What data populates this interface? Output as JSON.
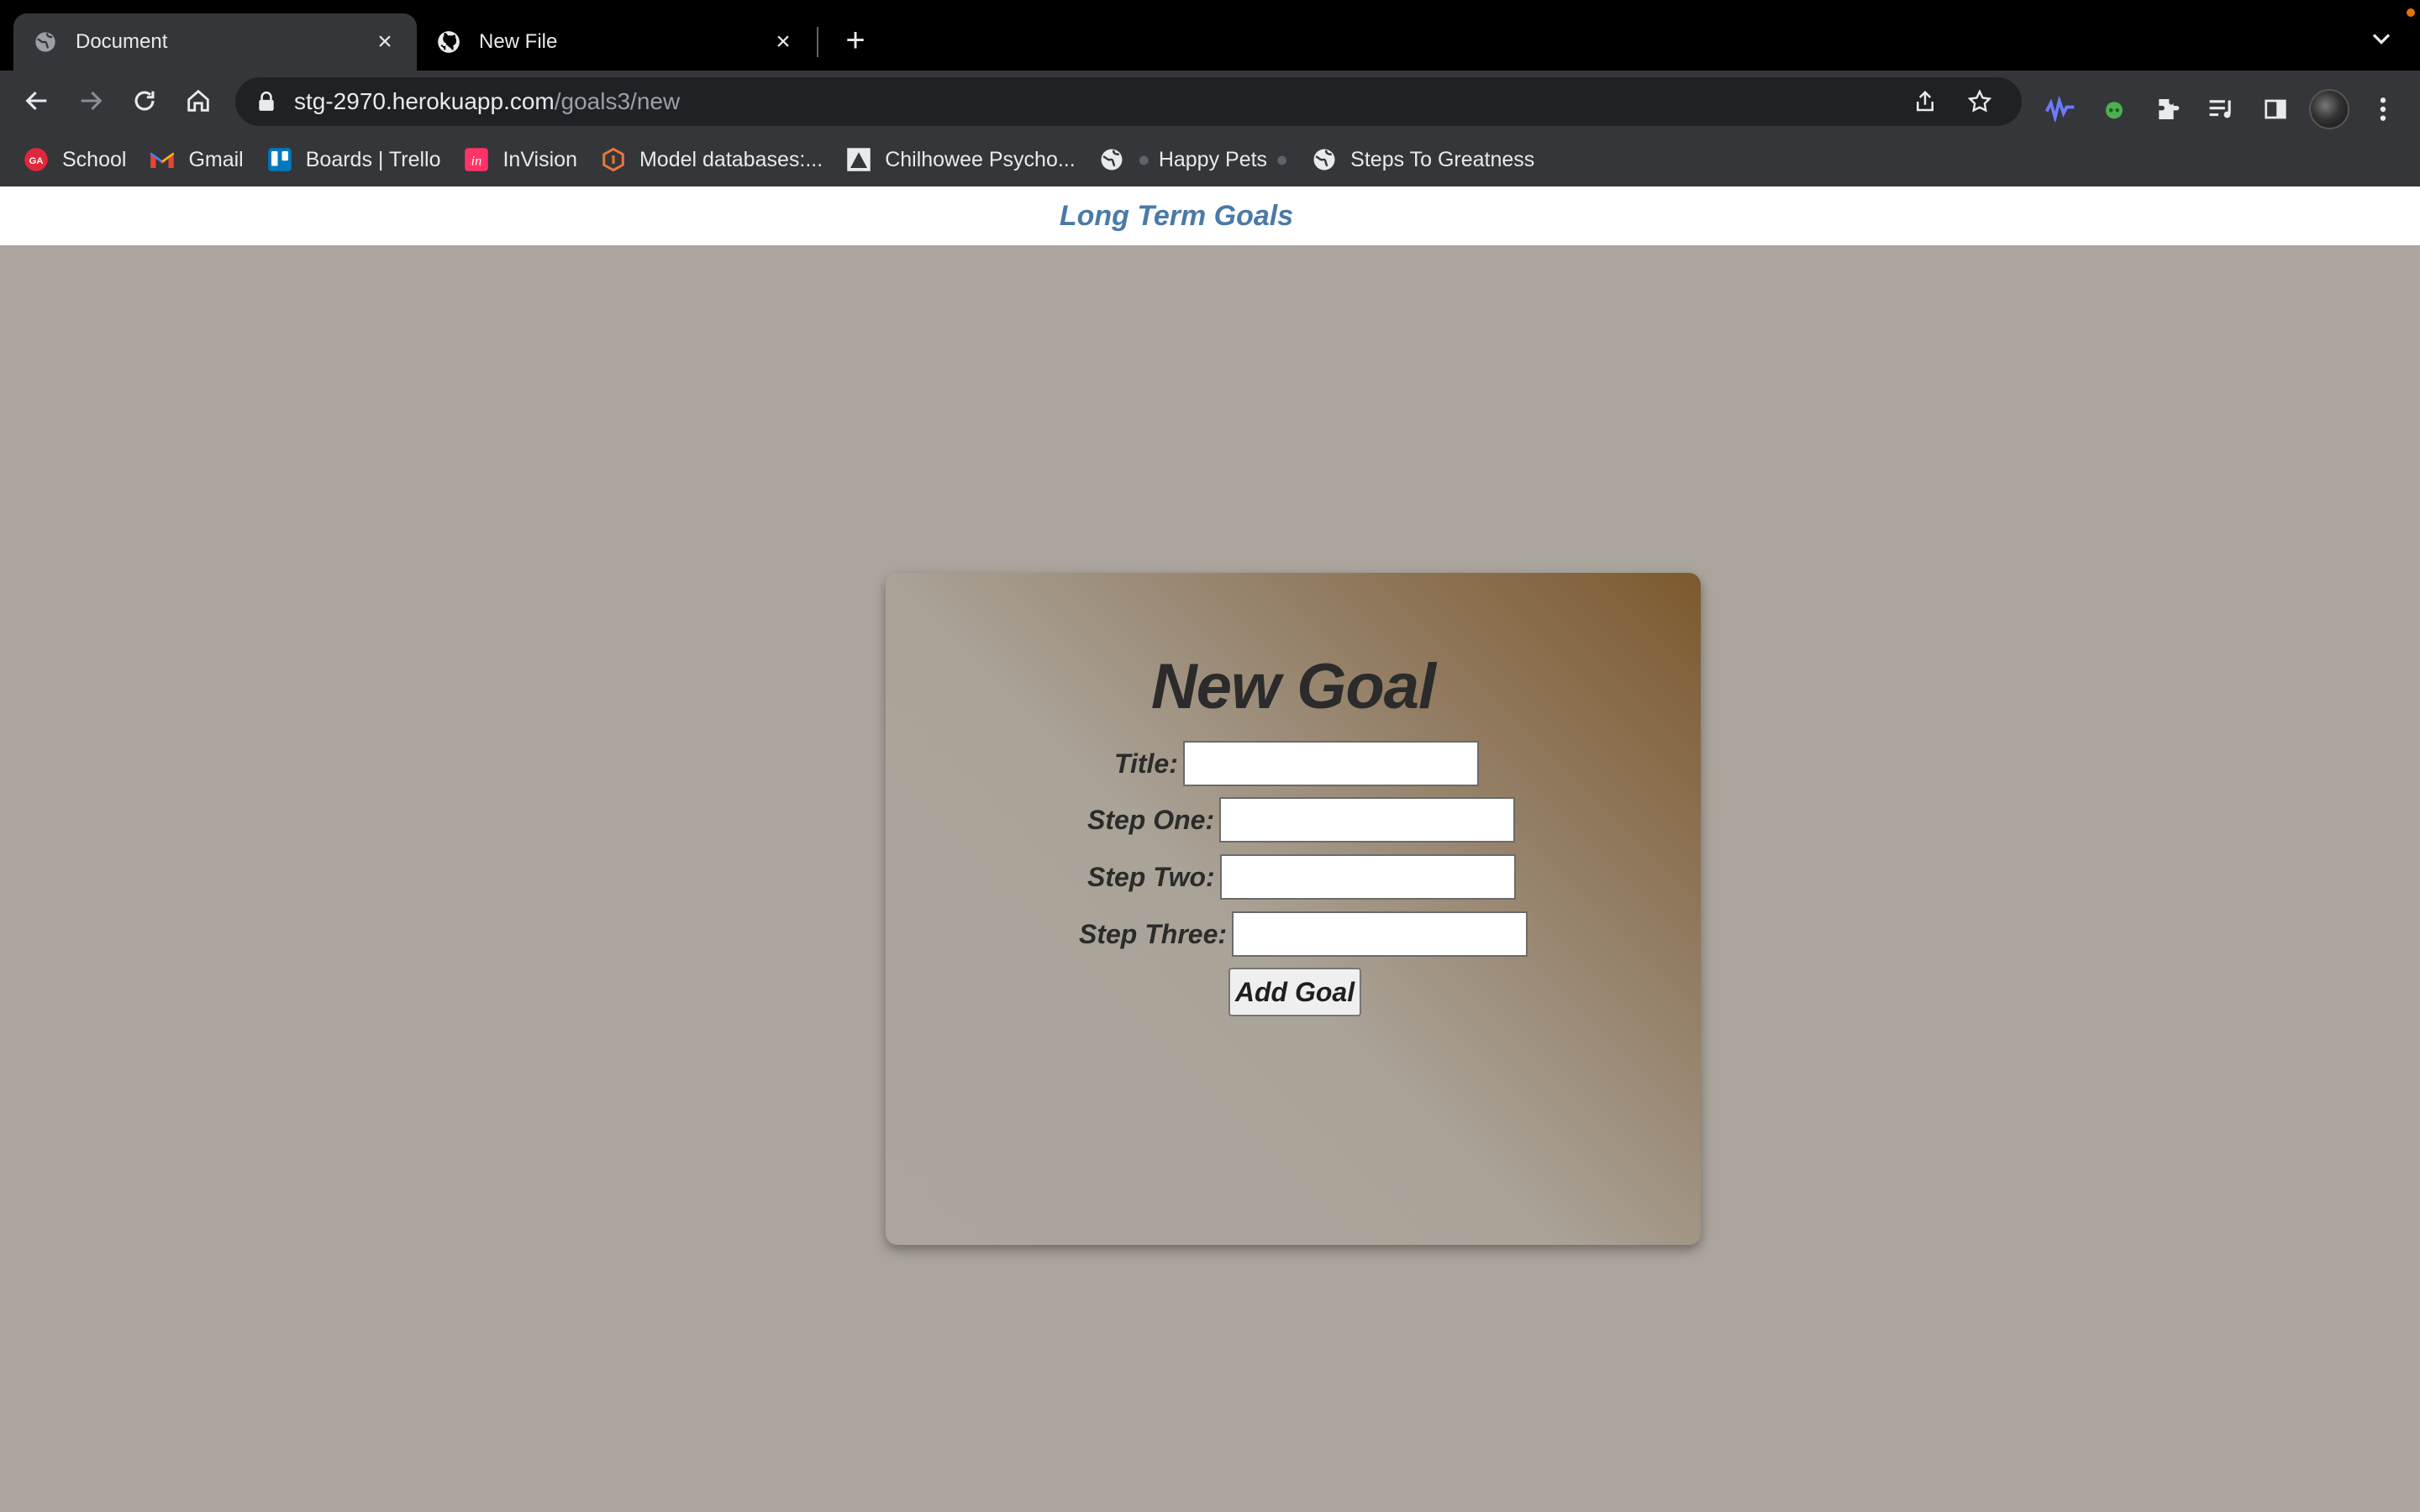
{
  "browser": {
    "tabs": [
      {
        "title": "Document",
        "active": true,
        "icon": "globe-icon"
      },
      {
        "title": "New File",
        "active": false,
        "icon": "github-icon"
      }
    ],
    "url_host": "stg-2970.herokuapp.com",
    "url_path": "/goals3/new",
    "bookmarks": [
      {
        "label": "School",
        "icon": "ga-icon"
      },
      {
        "label": "Gmail",
        "icon": "gmail-icon"
      },
      {
        "label": "Boards | Trello",
        "icon": "trello-icon"
      },
      {
        "label": "InVision",
        "icon": "invision-icon"
      },
      {
        "label": "Model databases:...",
        "icon": "model-db-icon"
      },
      {
        "label": "Chilhowee Psycho...",
        "icon": "chilhowee-icon"
      },
      {
        "label": "Happy Pets",
        "icon": "globe-icon"
      },
      {
        "label": "Steps To Greatness",
        "icon": "globe-icon"
      }
    ]
  },
  "page": {
    "header_title": "Long Term Goals",
    "form": {
      "heading": "New Goal",
      "fields": [
        {
          "label": "Title:",
          "value": ""
        },
        {
          "label": "Step One:",
          "value": ""
        },
        {
          "label": "Step Two:",
          "value": ""
        },
        {
          "label": "Step Three:",
          "value": ""
        }
      ],
      "submit_label": "Add Goal"
    }
  },
  "colors": {
    "page_background": "#aba59d",
    "header_title": "#4a7aa8",
    "card_gradient_accent": "#7d5a2e"
  }
}
